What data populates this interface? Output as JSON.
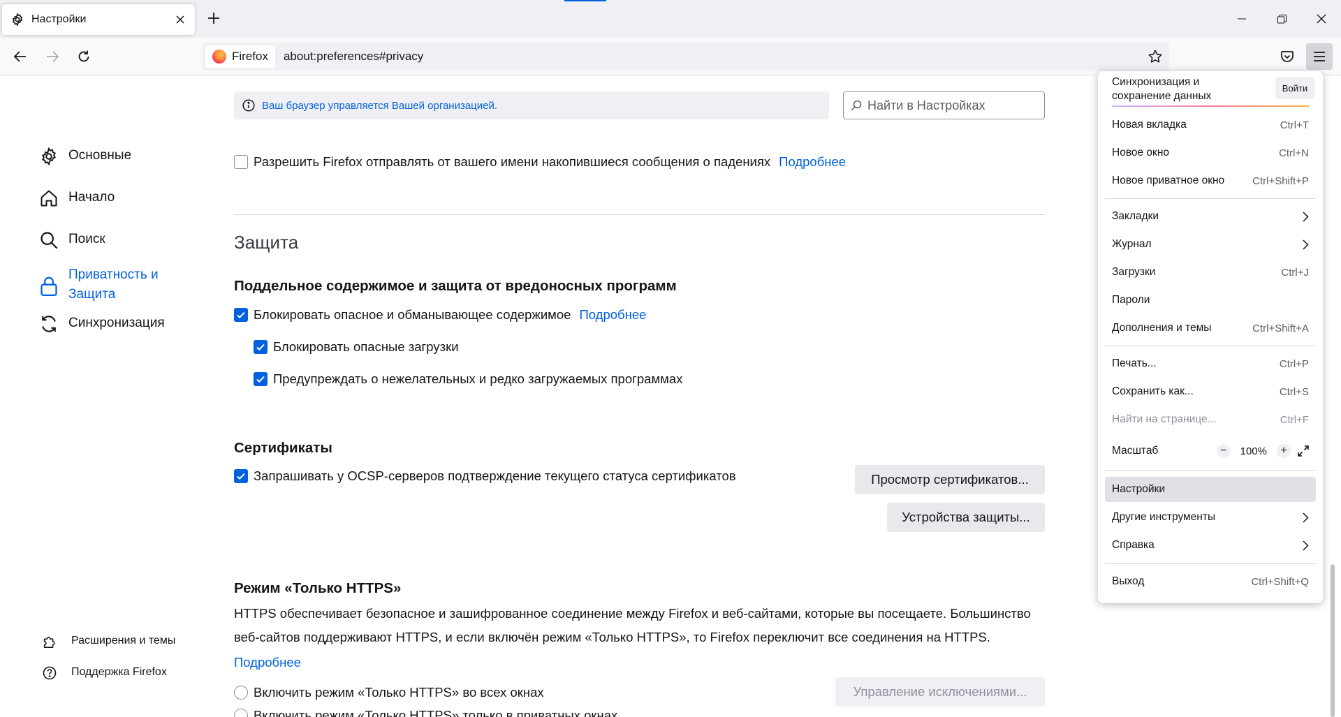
{
  "window": {
    "tab_title": "Настройки",
    "url_identity": "Firefox",
    "url": "about:preferences#privacy"
  },
  "sidebar": {
    "items": [
      {
        "label": "Основные",
        "icon": "gear-icon"
      },
      {
        "label": "Начало",
        "icon": "home-icon"
      },
      {
        "label": "Поиск",
        "icon": "search-icon"
      },
      {
        "label": "Приватность и\nЗащита",
        "icon": "lock-icon",
        "active": true
      },
      {
        "label": "Синхронизация",
        "icon": "sync-icon"
      }
    ],
    "footer": [
      {
        "label": "Расширения и темы",
        "icon": "puzzle-icon"
      },
      {
        "label": "Поддержка Firefox",
        "icon": "help-icon"
      }
    ]
  },
  "policy_notice": "Ваш браузер управляется Вашей организацией.",
  "search": {
    "placeholder": "Найти в Настройках"
  },
  "crash_reports": {
    "label": "Разрешить Firefox отправлять от вашего имени накопившиеся сообщения о падениях",
    "checked": false,
    "link": "Подробнее"
  },
  "section_title": "Защита",
  "deceptive": {
    "heading": "Поддельное содержимое и защита от вредоносных программ",
    "block_dangerous": {
      "label": "Блокировать опасное и обманывающее содержимое",
      "checked": true,
      "link": "Подробнее"
    },
    "block_downloads": {
      "label": "Блокировать опасные загрузки",
      "checked": true
    },
    "warn_unwanted": {
      "label": "Предупреждать о нежелательных и редко загружаемых программах",
      "checked": true
    }
  },
  "certificates": {
    "heading": "Сертификаты",
    "ocsp": {
      "label": "Запрашивать у OCSP-серверов подтверждение текущего статуса сертификатов",
      "checked": true
    },
    "view_button": "Просмотр сертификатов...",
    "devices_button": "Устройства защиты..."
  },
  "https_only": {
    "heading": "Режим «Только HTTPS»",
    "description": "HTTPS обеспечивает безопасное и зашифрованное соединение между Firefox и веб-сайтами, которые вы посещаете. Большинство веб-сайтов поддерживают HTTPS, и если включён режим «Только HTTPS», то Firefox переключит все соединения на HTTPS.",
    "link": "Подробнее",
    "option_all": "Включить режим «Только HTTPS» во всех окнах",
    "option_private": "Включить режим «Только HTTPS» только в приватных окнах",
    "exceptions_button": "Управление исключениями..."
  },
  "app_menu": {
    "sync_text": "Синхронизация и сохранение данных",
    "signin": "Войти",
    "items": [
      {
        "label": "Новая вкладка",
        "shortcut": "Ctrl+T"
      },
      {
        "label": "Новое окно",
        "shortcut": "Ctrl+N"
      },
      {
        "label": "Новое приватное окно",
        "shortcut": "Ctrl+Shift+P"
      },
      {
        "label": "Закладки",
        "shortcut": ""
      },
      {
        "label": "Журнал",
        "shortcut": ""
      },
      {
        "label": "Загрузки",
        "shortcut": "Ctrl+J"
      },
      {
        "label": "Пароли",
        "shortcut": ""
      },
      {
        "label": "Дополнения и темы",
        "shortcut": "Ctrl+Shift+A"
      },
      {
        "label": "Печать...",
        "shortcut": "Ctrl+P"
      },
      {
        "label": "Сохранить как...",
        "shortcut": "Ctrl+S"
      },
      {
        "label": "Найти на странице...",
        "shortcut": "Ctrl+F"
      },
      {
        "label": "Масштаб",
        "shortcut": ""
      },
      {
        "label": "Настройки",
        "shortcut": ""
      },
      {
        "label": "Другие инструменты",
        "shortcut": ""
      },
      {
        "label": "Справка",
        "shortcut": ""
      },
      {
        "label": "Выход",
        "shortcut": "Ctrl+Shift+Q"
      }
    ],
    "zoom_minus": "−",
    "zoom_value": "100%",
    "zoom_plus": "+"
  },
  "colors": {
    "accent": "#0061e0",
    "menu_highlight": "#e0e0e6"
  }
}
